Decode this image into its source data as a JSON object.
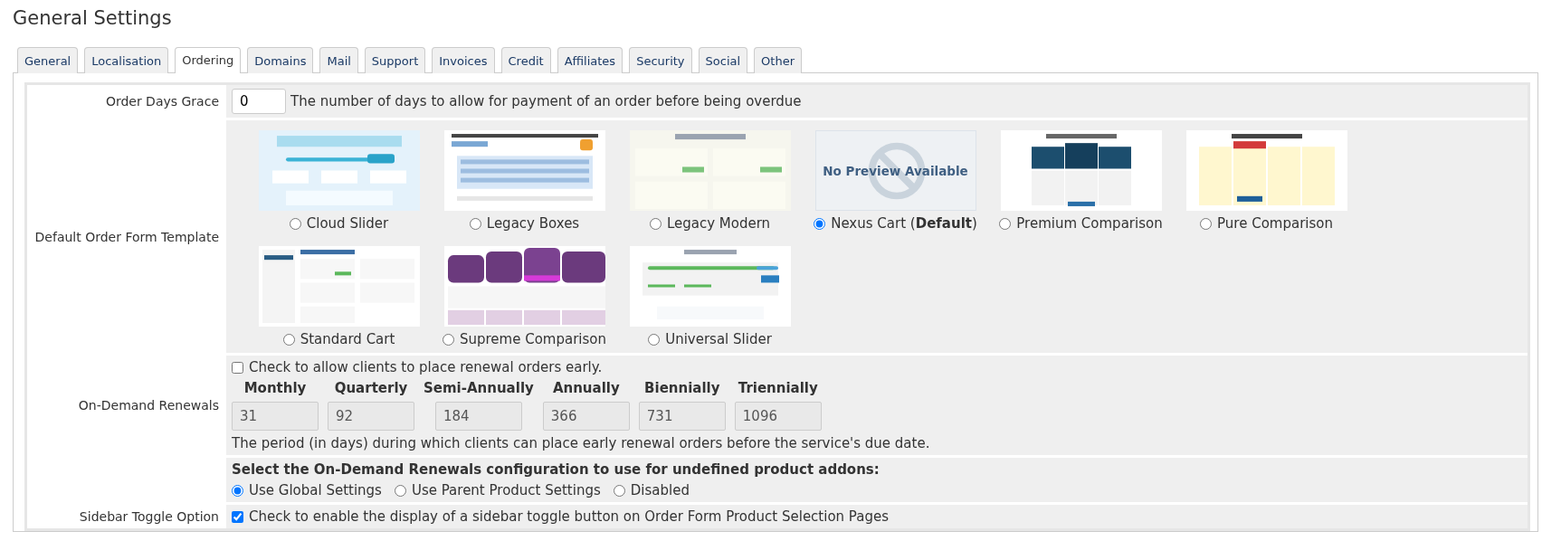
{
  "title": "General Settings",
  "tabs": [
    {
      "label": "General",
      "selected": false
    },
    {
      "label": "Localisation",
      "selected": false
    },
    {
      "label": "Ordering",
      "selected": true
    },
    {
      "label": "Domains",
      "selected": false
    },
    {
      "label": "Mail",
      "selected": false
    },
    {
      "label": "Support",
      "selected": false
    },
    {
      "label": "Invoices",
      "selected": false
    },
    {
      "label": "Credit",
      "selected": false
    },
    {
      "label": "Affiliates",
      "selected": false
    },
    {
      "label": "Security",
      "selected": false
    },
    {
      "label": "Social",
      "selected": false
    },
    {
      "label": "Other",
      "selected": false
    }
  ],
  "order_days_grace": {
    "label": "Order Days Grace",
    "value": "0",
    "help": "The number of days to allow for payment of an order before being overdue"
  },
  "order_form_template": {
    "label": "Default Order Form Template",
    "options": [
      {
        "name": "Cloud Slider",
        "selected": false
      },
      {
        "name": "Legacy Boxes",
        "selected": false
      },
      {
        "name": "Legacy Modern",
        "selected": false
      },
      {
        "name": "Nexus Cart (**Default**)",
        "selected": true,
        "preview": {
          "kind": "no-preview",
          "text": "No Preview Available"
        }
      },
      {
        "name": "Premium Comparison",
        "selected": false
      },
      {
        "name": "Pure Comparison",
        "selected": false
      },
      {
        "name": "Standard Cart",
        "selected": false
      },
      {
        "name": "Supreme Comparison",
        "selected": false
      },
      {
        "name": "Universal Slider",
        "selected": false
      }
    ]
  },
  "on_demand_renewals": {
    "label": "On-Demand Renewals",
    "checkbox": {
      "checked": false,
      "label": "Check to allow clients to place renewal orders early."
    },
    "periods": [
      {
        "name": "Monthly",
        "value": "31",
        "disabled": true
      },
      {
        "name": "Quarterly",
        "value": "92",
        "disabled": true
      },
      {
        "name": "Semi-Annually",
        "value": "184",
        "disabled": true
      },
      {
        "name": "Annually",
        "value": "366",
        "disabled": true
      },
      {
        "name": "Biennially",
        "value": "731",
        "disabled": true
      },
      {
        "name": "Triennially",
        "value": "1096",
        "disabled": true
      }
    ],
    "help": "The period (in days) during which clients can place early renewal orders before the service's due date."
  },
  "addon_renewals": {
    "heading": "Select the On-Demand Renewals configuration to use for undefined product addons:",
    "options": [
      {
        "label": "Use Global Settings",
        "selected": true
      },
      {
        "label": "Use Parent Product Settings",
        "selected": false
      },
      {
        "label": "Disabled",
        "selected": false
      }
    ]
  },
  "sidebar_toggle": {
    "label": "Sidebar Toggle Option",
    "checkbox": {
      "checked": true,
      "label": "Check to enable the display of a sidebar toggle button on Order Form Product Selection Pages"
    }
  }
}
